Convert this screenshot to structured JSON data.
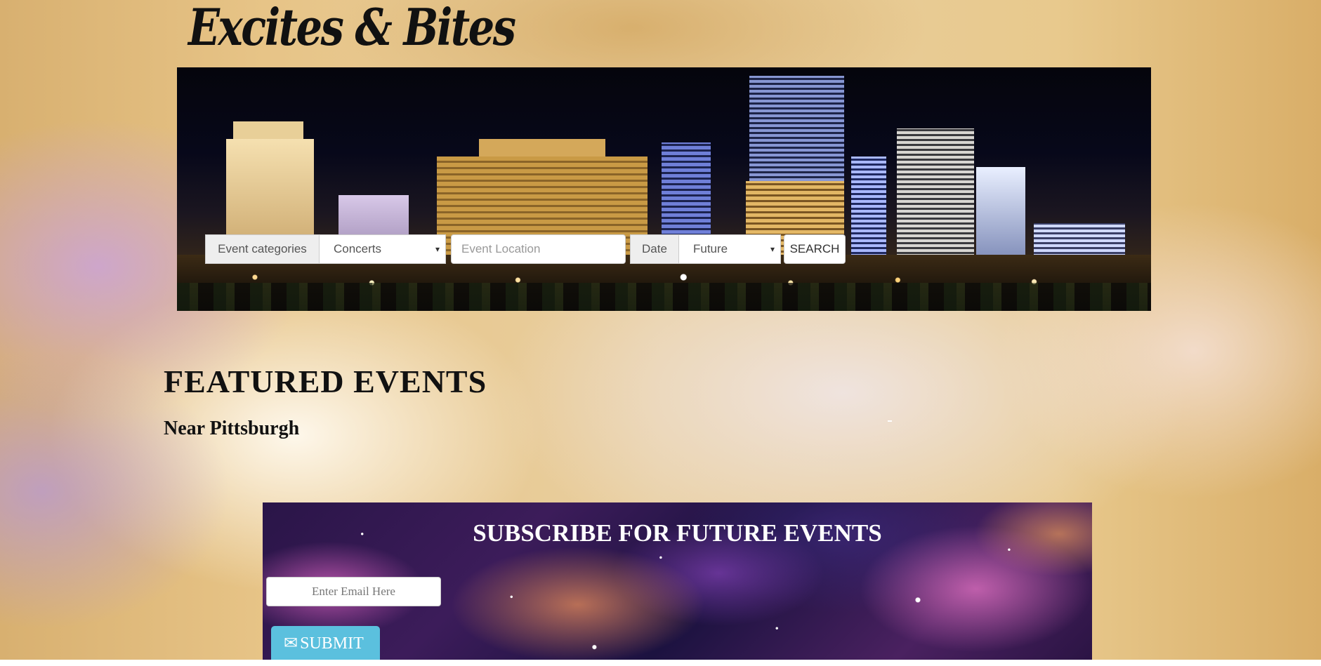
{
  "brand": {
    "logo_text": "Excites & Bites"
  },
  "search": {
    "categories_label": "Event categories",
    "category_value": "Concerts",
    "location_placeholder": "Event Location",
    "date_label": "Date",
    "date_value": "Future",
    "search_button": "SEARCH",
    "caret_icon": "chevron-down-icon"
  },
  "featured": {
    "heading": "FEATURED EVENTS",
    "subheading": "Near Pittsburgh"
  },
  "subscribe": {
    "heading": "SUBSCRIBE FOR FUTURE EVENTS",
    "email_placeholder": "Enter Email Here",
    "submit_label": "SUBMIT",
    "submit_icon": "envelope-icon"
  },
  "colors": {
    "submit_button": "#5bc0de",
    "text_dark": "#111111",
    "background_warm": "#e8c98a"
  }
}
